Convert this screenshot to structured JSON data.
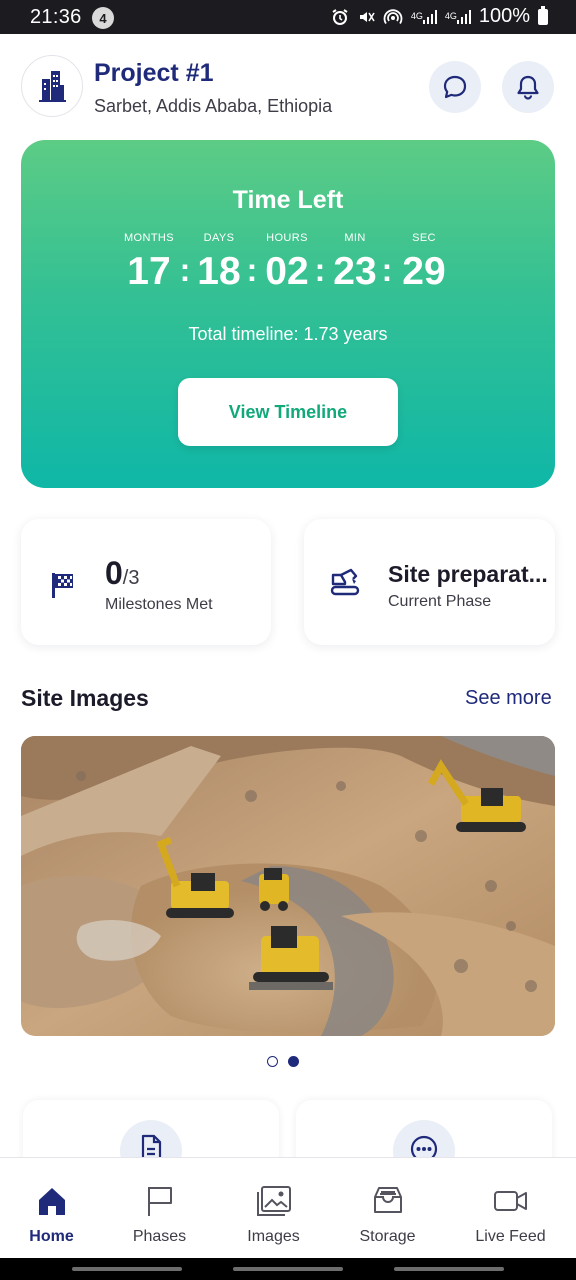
{
  "status_bar": {
    "time": "21:36",
    "notification_count": "4",
    "network_1": "4G",
    "network_2": "4G",
    "battery": "100%"
  },
  "header": {
    "title": "Project #1",
    "location": "Sarbet, Addis Ababa, Ethiopia",
    "logo_icon": "city-buildings-icon",
    "chat_icon": "chat-bubble-icon",
    "notifications_icon": "bell-icon"
  },
  "timer_card": {
    "title": "Time Left",
    "units": [
      {
        "label": "MONTHS",
        "value": "17"
      },
      {
        "label": "DAYS",
        "value": "18"
      },
      {
        "label": "HOURS",
        "value": "02"
      },
      {
        "label": "MIN",
        "value": "23"
      },
      {
        "label": "SEC",
        "value": "29"
      }
    ],
    "separator": ":",
    "total_timeline": "Total timeline: 1.73 years",
    "button_label": "View Timeline",
    "gradient_top": "#5dcc85",
    "gradient_bottom": "#0fb7a7"
  },
  "stats": {
    "milestones": {
      "value": "0",
      "total": "/3",
      "label": "Milestones Met",
      "icon": "checkered-flag-icon"
    },
    "phase": {
      "value": "Site preparat...",
      "label": "Current Phase",
      "icon": "excavator-icon"
    }
  },
  "site_images": {
    "heading": "Site Images",
    "see_more": "See more",
    "current_slide": 2,
    "slide_count": 2
  },
  "quick_cards": [
    {
      "icon": "document-icon"
    },
    {
      "icon": "more-dots-icon"
    }
  ],
  "bottom_nav": {
    "active": "Home",
    "items": [
      {
        "label": "Home",
        "icon": "home-icon"
      },
      {
        "label": "Phases",
        "icon": "flag-icon"
      },
      {
        "label": "Images",
        "icon": "images-icon"
      },
      {
        "label": "Storage",
        "icon": "storage-icon"
      },
      {
        "label": "Live Feed",
        "icon": "video-camera-icon"
      }
    ]
  },
  "colors": {
    "brand_navy": "#1f2a7a",
    "accent_green": "#12a97a"
  }
}
